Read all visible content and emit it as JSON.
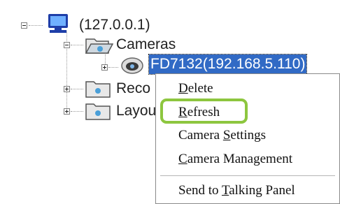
{
  "tree": {
    "root": {
      "label": "(127.0.0.1)",
      "icon": "computer-icon",
      "expanded": true
    },
    "cameras": {
      "label": "Cameras",
      "icon": "open-folder-icon",
      "expanded": true
    },
    "camera": {
      "label": "FD7132(192.168.5.110)",
      "icon": "camera-icon",
      "selected": true
    },
    "recordings": {
      "label": "Reco",
      "icon": "folder-icon"
    },
    "layouts": {
      "label": "Layou",
      "icon": "folder-icon"
    }
  },
  "context_menu": {
    "items": [
      {
        "first": "D",
        "rest": "elete"
      },
      {
        "first": "R",
        "rest": "efresh",
        "highlighted": true
      },
      {
        "pre": "Camera ",
        "first": "S",
        "rest": "ettings"
      },
      {
        "first": "C",
        "rest": "amera Management"
      },
      {
        "pre": "Send to ",
        "first": "T",
        "rest": "alking Panel"
      }
    ]
  },
  "colors": {
    "selection": "#316ac5",
    "highlight_ring": "#8dc63f",
    "folder": "#4a9fd8"
  }
}
